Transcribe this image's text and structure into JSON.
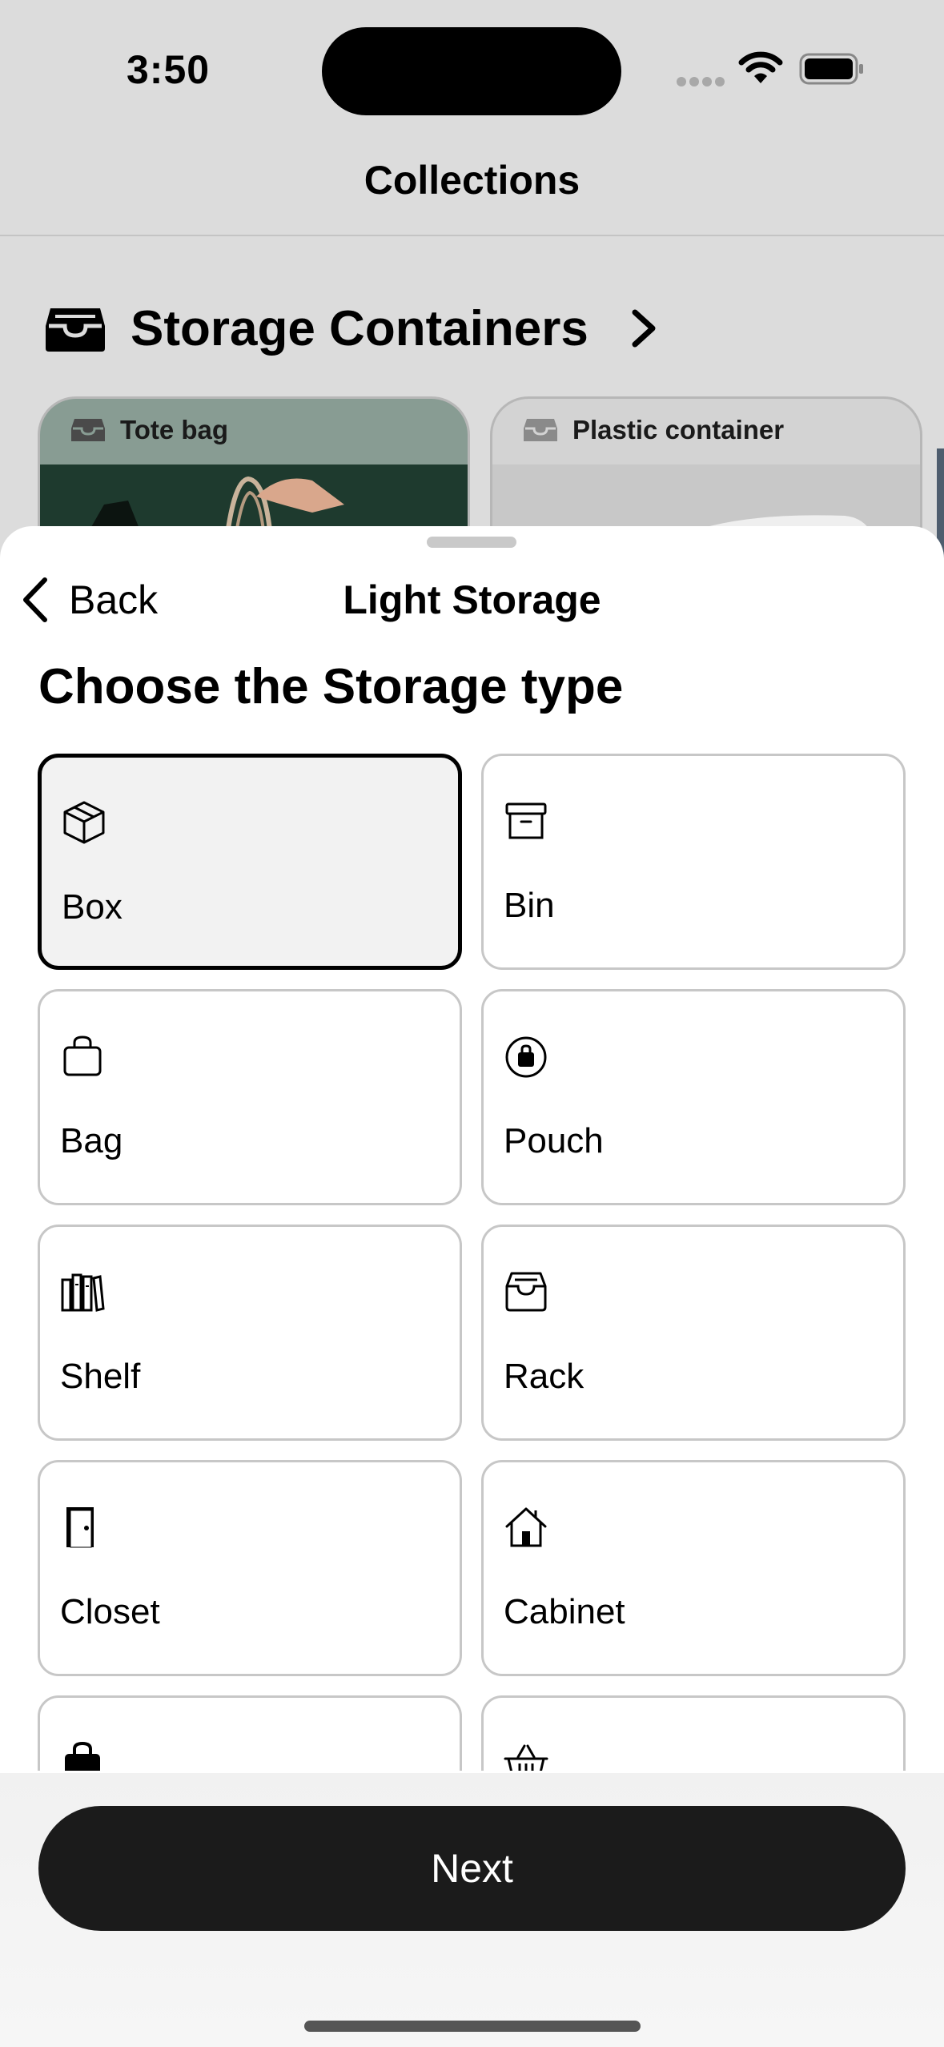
{
  "status_bar": {
    "time": "3:50"
  },
  "background": {
    "nav_title": "Collections",
    "section_title": "Storage Containers",
    "cards": [
      {
        "label": "Tote bag"
      },
      {
        "label": "Plastic container"
      }
    ]
  },
  "sheet": {
    "back_label": "Back",
    "title": "Light Storage",
    "prompt": "Choose the Storage type",
    "options": [
      {
        "label": "Box",
        "icon": "cube-box-icon",
        "selected": true
      },
      {
        "label": "Bin",
        "icon": "archive-box-icon",
        "selected": false
      },
      {
        "label": "Bag",
        "icon": "bag-icon",
        "selected": false
      },
      {
        "label": "Pouch",
        "icon": "pouch-icon",
        "selected": false
      },
      {
        "label": "Shelf",
        "icon": "books-shelf-icon",
        "selected": false
      },
      {
        "label": "Rack",
        "icon": "tray-icon",
        "selected": false
      },
      {
        "label": "Closet",
        "icon": "door-icon",
        "selected": false
      },
      {
        "label": "Cabinet",
        "icon": "house-icon",
        "selected": false
      },
      {
        "label": "",
        "icon": "bag-filled-icon",
        "selected": false
      },
      {
        "label": "",
        "icon": "basket-icon",
        "selected": false
      }
    ],
    "next_label": "Next"
  },
  "colors": {
    "selected_border": "#000000",
    "button_bg": "#1b1b1b"
  }
}
